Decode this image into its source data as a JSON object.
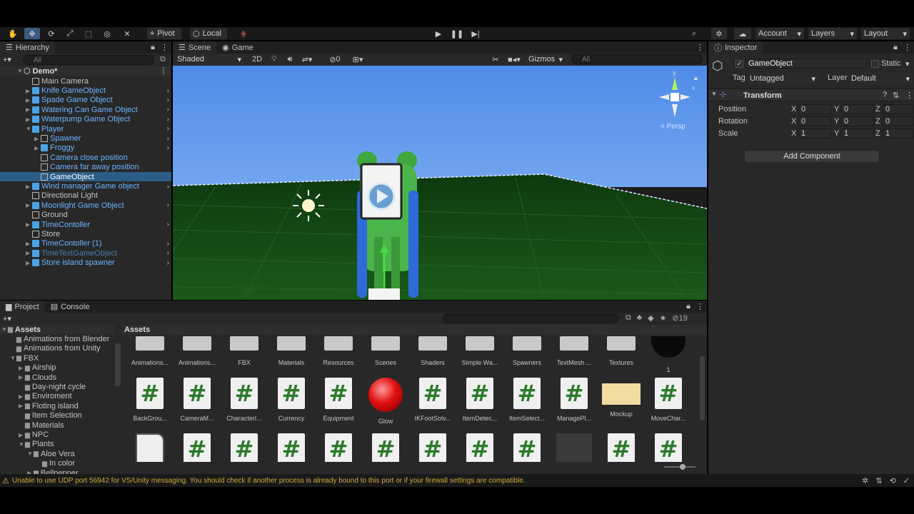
{
  "toolbar": {
    "pivot": "Pivot",
    "local": "Local",
    "account": "Account",
    "layers": "Layers",
    "layout": "Layout"
  },
  "hierarchy": {
    "tab": "Hierarchy",
    "search_placeholder": "All",
    "scene": "Demo*",
    "items": [
      {
        "label": "Main Camera",
        "indent": 1,
        "color": "white",
        "icon": "g",
        "expand": false
      },
      {
        "label": "Knife GameObject",
        "indent": 1,
        "color": "blue",
        "icon": "b",
        "expand": true
      },
      {
        "label": "Spade Game Object",
        "indent": 1,
        "color": "blue",
        "icon": "b",
        "expand": true
      },
      {
        "label": "Watering Can Game Object",
        "indent": 1,
        "color": "blue",
        "icon": "b",
        "expand": true
      },
      {
        "label": "Waterpump Game Object",
        "indent": 1,
        "color": "blue",
        "icon": "b",
        "expand": true
      },
      {
        "label": "Player",
        "indent": 1,
        "color": "blue",
        "icon": "b",
        "expand": true
      },
      {
        "label": "Spawner",
        "indent": 2,
        "color": "blue",
        "icon": "g",
        "expand": true
      },
      {
        "label": "Froggy",
        "indent": 2,
        "color": "blue",
        "icon": "b",
        "expand": true
      },
      {
        "label": "Camera close position",
        "indent": 2,
        "color": "blue",
        "icon": "g",
        "expand": false
      },
      {
        "label": "Camera far away position",
        "indent": 2,
        "color": "blue",
        "icon": "g",
        "expand": false
      },
      {
        "label": "GameObject",
        "indent": 2,
        "color": "white",
        "icon": "g",
        "expand": false,
        "selected": true
      },
      {
        "label": "Wind manager Game object",
        "indent": 1,
        "color": "blue",
        "icon": "b",
        "expand": true
      },
      {
        "label": "Directional Light",
        "indent": 1,
        "color": "white",
        "icon": "g",
        "expand": false
      },
      {
        "label": "Moonlight Game Object",
        "indent": 1,
        "color": "blue",
        "icon": "b",
        "expand": true
      },
      {
        "label": "Ground",
        "indent": 1,
        "color": "white",
        "icon": "g",
        "expand": false
      },
      {
        "label": "TimeContoller",
        "indent": 1,
        "color": "blue",
        "icon": "b",
        "expand": true
      },
      {
        "label": "Store",
        "indent": 1,
        "color": "white",
        "icon": "g",
        "expand": false
      },
      {
        "label": "TimeContoller (1)",
        "indent": 1,
        "color": "blue",
        "icon": "b",
        "expand": true
      },
      {
        "label": "TimeTextGameObject",
        "indent": 1,
        "color": "dim",
        "icon": "b",
        "expand": true
      },
      {
        "label": "Store island spawner",
        "indent": 1,
        "color": "blue",
        "icon": "b",
        "expand": true
      }
    ]
  },
  "scene": {
    "tab_scene": "Scene",
    "tab_game": "Game",
    "shaded": "Shaded",
    "mode2d": "2D",
    "hidden_count": "0",
    "gizmos": "Gizmos",
    "search_placeholder": "All",
    "persp": "< Persp",
    "axis_y": "y",
    "axis_x": "x"
  },
  "inspector": {
    "tab": "Inspector",
    "object_name": "GameObject",
    "static": "Static",
    "tag_label": "Tag",
    "tag_value": "Untagged",
    "layer_label": "Layer",
    "layer_value": "Default",
    "transform": "Transform",
    "rows": [
      {
        "label": "Position",
        "x": "0",
        "y": "0",
        "z": "0"
      },
      {
        "label": "Rotation",
        "x": "0",
        "y": "0",
        "z": "0"
      },
      {
        "label": "Scale",
        "x": "1",
        "y": "1",
        "z": "1"
      }
    ],
    "x": "X",
    "y": "Y",
    "z": "Z",
    "add_component": "Add Component"
  },
  "project": {
    "tab_project": "Project",
    "tab_console": "Console",
    "hidden_count": "19",
    "assets_header": "Assets",
    "tree": [
      {
        "label": "Assets",
        "indent": 0,
        "bold": true,
        "expand": "open"
      },
      {
        "label": "Animations from Blender",
        "indent": 1,
        "expand": "none"
      },
      {
        "label": "Animations from Unity",
        "indent": 1,
        "expand": "none"
      },
      {
        "label": "FBX",
        "indent": 1,
        "expand": "open"
      },
      {
        "label": "Airship",
        "indent": 2,
        "expand": "closed"
      },
      {
        "label": "Clouds",
        "indent": 2,
        "expand": "closed"
      },
      {
        "label": "Day-night cycle",
        "indent": 2,
        "expand": "none"
      },
      {
        "label": "Enviroment",
        "indent": 2,
        "expand": "closed"
      },
      {
        "label": "Floting island",
        "indent": 2,
        "expand": "closed"
      },
      {
        "label": "Item Selection",
        "indent": 2,
        "expand": "none"
      },
      {
        "label": "Materials",
        "indent": 2,
        "expand": "none"
      },
      {
        "label": "NPC",
        "indent": 2,
        "expand": "closed"
      },
      {
        "label": "Plants",
        "indent": 2,
        "expand": "open"
      },
      {
        "label": "Aloe Vera",
        "indent": 3,
        "expand": "open"
      },
      {
        "label": "In color",
        "indent": 4,
        "expand": "none"
      },
      {
        "label": "Bellpepper",
        "indent": 3,
        "expand": "closed"
      }
    ],
    "row1": [
      "Animations...",
      "Animations...",
      "FBX",
      "Materials",
      "Resources",
      "Scenes",
      "Shaders",
      "Simple Wa...",
      "Spawners",
      "TextMesh ...",
      "Textures",
      "1"
    ],
    "row2": [
      "BackGrou...",
      "CameraM...",
      "CharacterI...",
      "Currency",
      "Equipment",
      "Glow",
      "IKFootSolv...",
      "ItemDetec...",
      "ItemSelect...",
      "ManagePl...",
      "Mockup",
      "MoveChar..."
    ]
  },
  "status": {
    "message": "Unable to use UDP port 56942 for VS/Unity messaging. You should check if another process is already bound to this port or if your firewall settings are compatible."
  }
}
